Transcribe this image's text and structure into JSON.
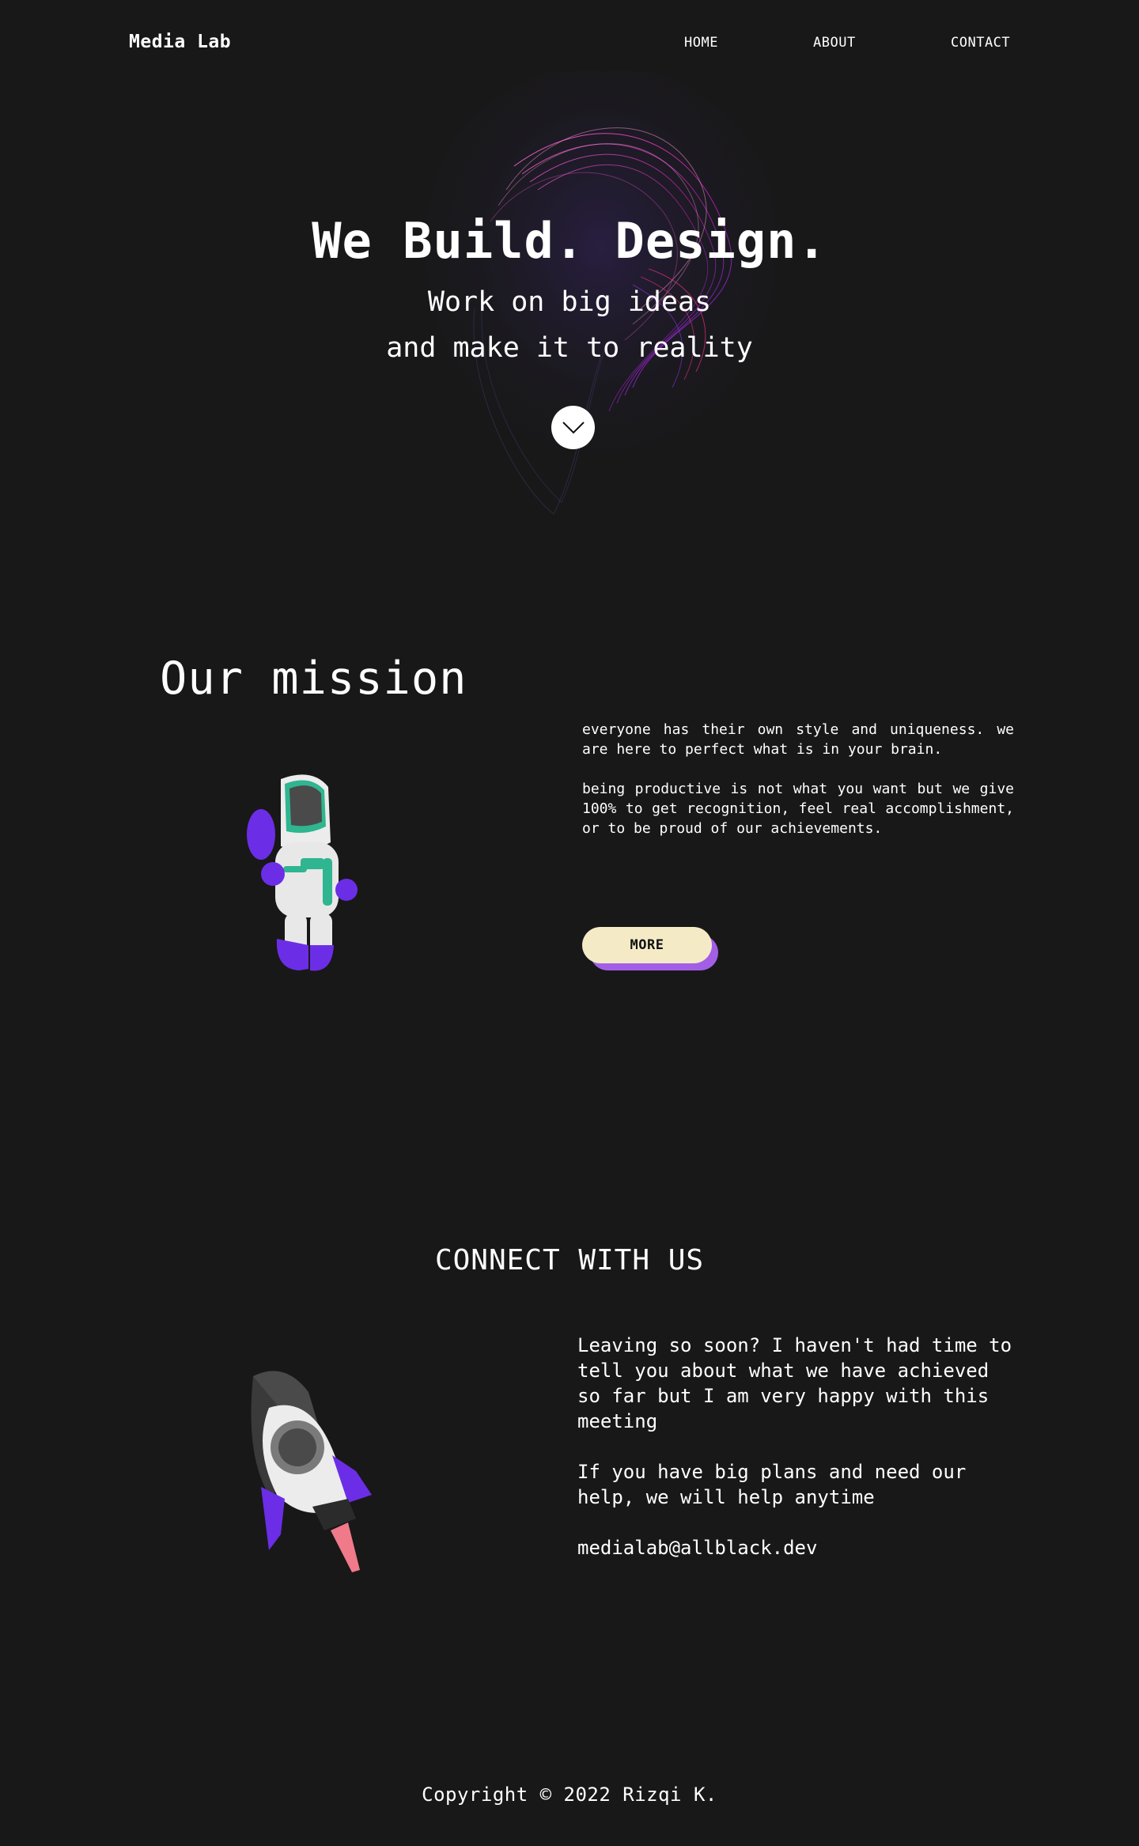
{
  "brand": "Media Lab",
  "nav": {
    "home": "HOME",
    "about": "ABOUT",
    "contact": "CONTACT"
  },
  "hero": {
    "title": "We Build. Design.",
    "line1": "Work on big ideas",
    "line2": "and make it to reality",
    "scroll_icon": "chevron-down-icon"
  },
  "mission": {
    "title": "Our mission",
    "para1": "everyone has their own style and uniqueness. we are here to perfect what is in your brain.",
    "para2": "being productive is not what you want but we give 100% to get recognition, feel real accomplishment, or to be proud of our achievements.",
    "more_label": "MORE"
  },
  "connect": {
    "title": "CONNECT WITH US",
    "para1": "Leaving so soon? I haven't had time to tell you about what we have achieved so far but I am very happy with this meeting",
    "para2": "If you have big plans and need our help, we will help anytime",
    "email": "medialab@allblack.dev"
  },
  "footer": "Copyright © 2022 Rizqi K.",
  "colors": {
    "background": "#181818",
    "accent_purple": "#6b2ee6",
    "button_cream": "#f4ebc6",
    "button_shadow": "#a35ee6",
    "astronaut_teal": "#2fb58f"
  }
}
